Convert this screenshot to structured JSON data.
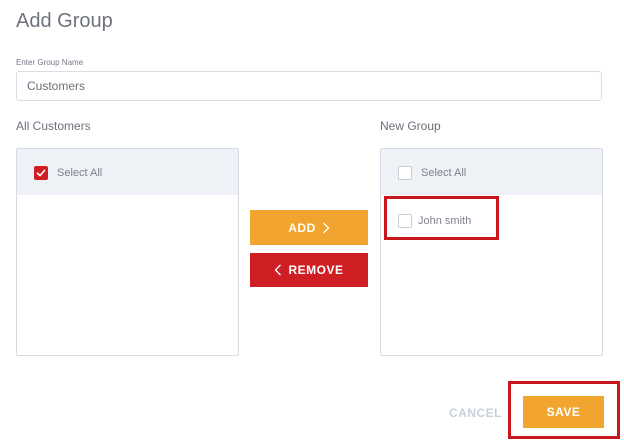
{
  "dialog": {
    "title": "Add Group"
  },
  "group_name": {
    "label": "Enter Group Name",
    "value": "Customers"
  },
  "left_panel": {
    "heading": "All Customers",
    "select_all": {
      "label": "Select All",
      "checked": true
    },
    "items": []
  },
  "right_panel": {
    "heading": "New Group",
    "select_all": {
      "label": "Select All",
      "checked": false
    },
    "items": [
      {
        "label": "John smith",
        "checked": false
      }
    ]
  },
  "actions": {
    "add_label": "ADD",
    "remove_label": "REMOVE"
  },
  "footer": {
    "cancel_label": "CANCEL",
    "save_label": "SAVE"
  },
  "colors": {
    "accent_orange": "#f2a52e",
    "accent_red": "#cf1f24",
    "highlight_red": "#c8161d"
  },
  "icons": {
    "add": "chevron-right-icon",
    "remove": "chevron-left-icon",
    "checked": "check-icon"
  }
}
